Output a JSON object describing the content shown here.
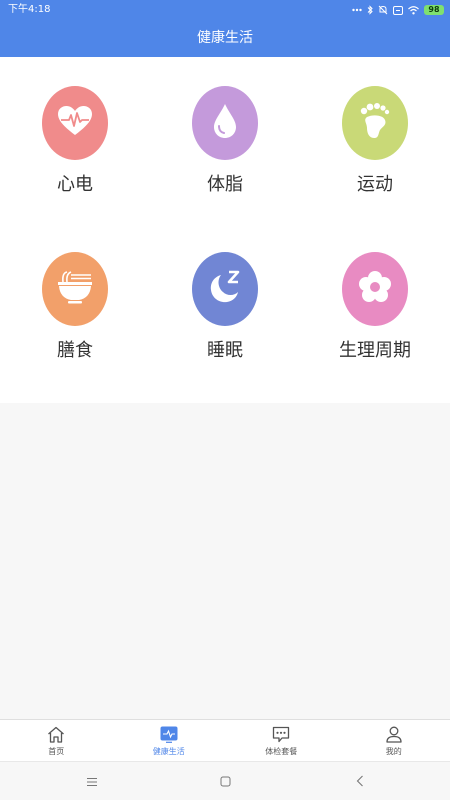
{
  "status_bar": {
    "time": "下午4:18",
    "battery": "98",
    "icons": [
      "dots-icon",
      "bluetooth-icon",
      "mute-icon",
      "sim-icon",
      "wifi-icon",
      "battery-icon"
    ]
  },
  "header": {
    "title": "健康生活"
  },
  "features": [
    {
      "label": "心电",
      "icon": "heart-ecg-icon",
      "color": "#f08b8b"
    },
    {
      "label": "体脂",
      "icon": "water-drop-icon",
      "color": "#c49adb"
    },
    {
      "label": "运动",
      "icon": "footprint-icon",
      "color": "#c9d977"
    },
    {
      "label": "膳食",
      "icon": "noodle-bowl-icon",
      "color": "#f2a06a"
    },
    {
      "label": "睡眠",
      "icon": "moon-sleep-icon",
      "color": "#7186d4"
    },
    {
      "label": "生理周期",
      "icon": "flower-icon",
      "color": "#e88bc2"
    }
  ],
  "tabbar": {
    "active_color": "#4f86e8",
    "items": [
      {
        "label": "首页",
        "icon": "home-icon",
        "active": false
      },
      {
        "label": "健康生活",
        "icon": "pulse-icon",
        "active": true
      },
      {
        "label": "体检套餐",
        "icon": "chat-bubble-icon",
        "active": false
      },
      {
        "label": "我的",
        "icon": "user-icon",
        "active": false
      }
    ]
  },
  "system_nav": {
    "icons": [
      "menu-icon",
      "home-square-icon",
      "back-icon"
    ]
  }
}
